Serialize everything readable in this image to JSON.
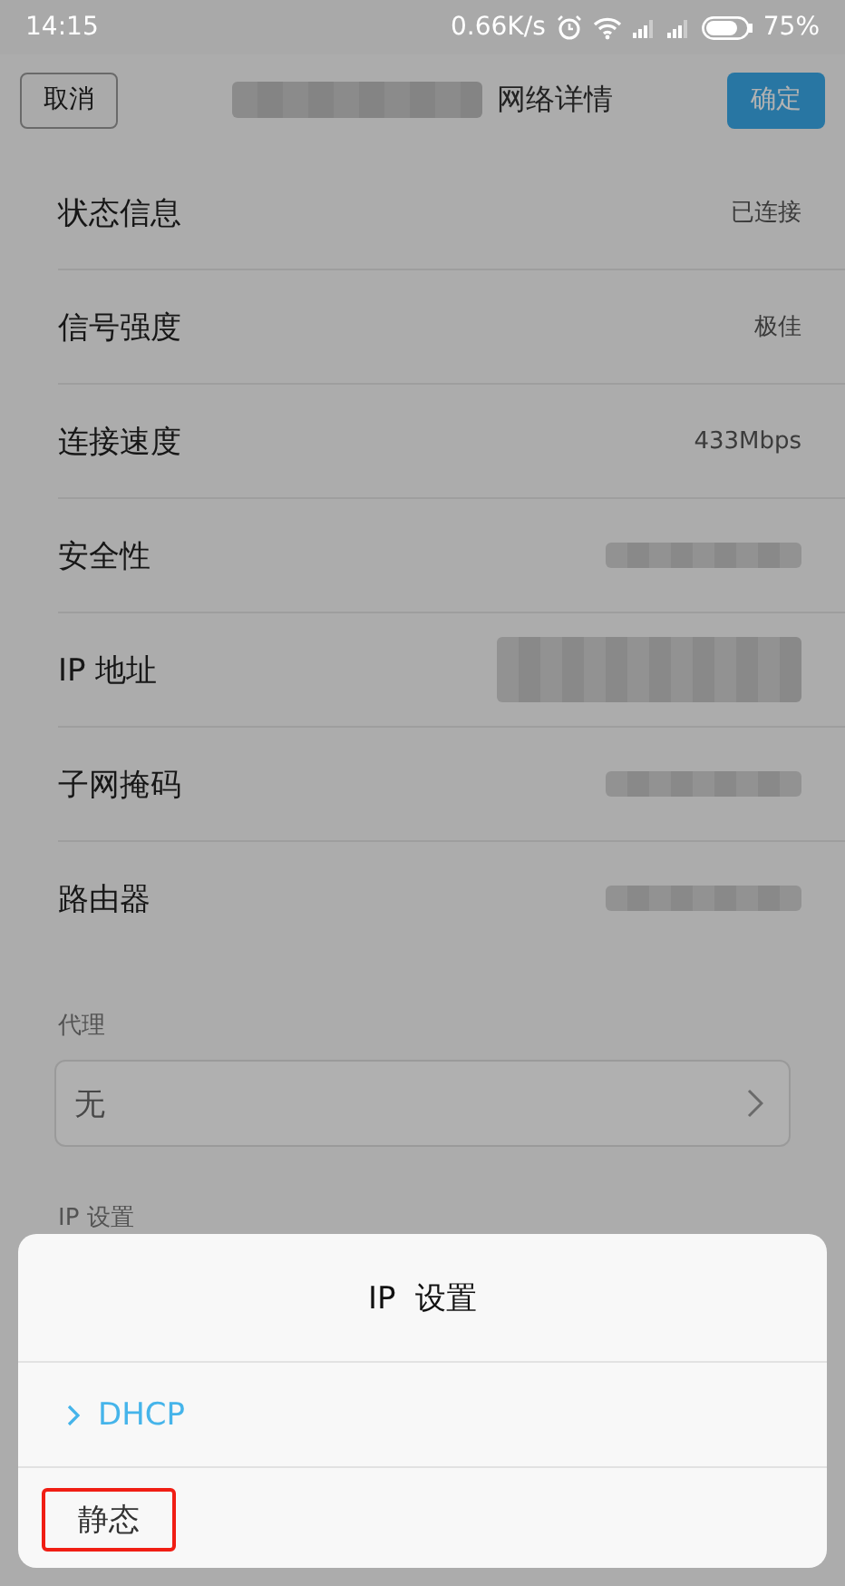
{
  "status_bar": {
    "time": "14:15",
    "speed": "0.66K/s",
    "battery": "75%"
  },
  "header": {
    "cancel": "取消",
    "title": "网络详情",
    "title_redacted": true,
    "confirm": "确定"
  },
  "rows": [
    {
      "label": "状态信息",
      "kind": "text",
      "value": "已连接"
    },
    {
      "label": "信号强度",
      "kind": "text",
      "value": "极佳"
    },
    {
      "label": "连接速度",
      "kind": "text",
      "value": "433Mbps"
    },
    {
      "label": "安全性",
      "kind": "redacted"
    },
    {
      "label": "IP 地址",
      "kind": "redacted_two_line"
    },
    {
      "label": "子网掩码",
      "kind": "redacted"
    },
    {
      "label": "路由器",
      "kind": "redacted"
    }
  ],
  "proxy": {
    "label": "代理",
    "value": "无"
  },
  "ip_settings_label": "IP 设置",
  "dialog": {
    "title": "IP  设置",
    "options": [
      {
        "label": "DHCP",
        "selected": true,
        "highlighted": false
      },
      {
        "label": "静态",
        "selected": false,
        "highlighted": true
      }
    ]
  }
}
